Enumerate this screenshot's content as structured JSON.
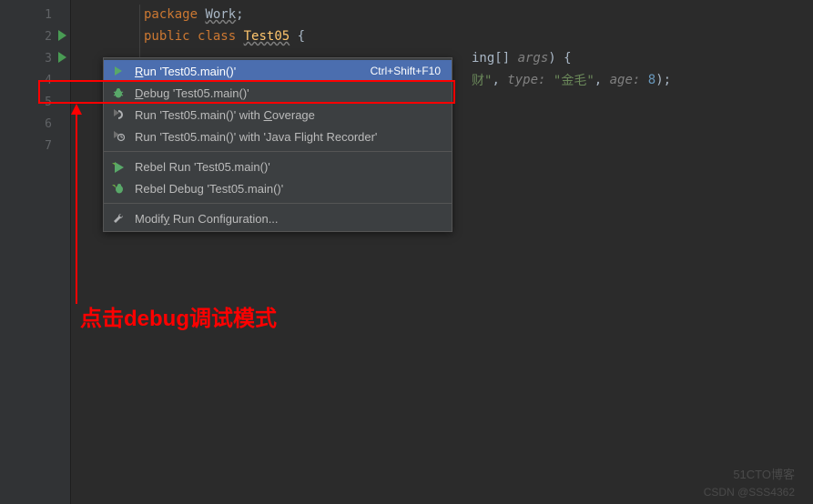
{
  "gutter": {
    "lines": [
      "1",
      "2",
      "3",
      "4",
      "5",
      "6",
      "7"
    ]
  },
  "code": {
    "line1": {
      "kw": "package",
      "name": "Work",
      "semi": ";"
    },
    "line2": {
      "kw1": "public",
      "kw2": "class",
      "cls": "Test05",
      "brace": " {"
    },
    "line3_tail": {
      "type": "ing[] ",
      "arg": "args",
      "paren": ") {"
    },
    "line4_tail": {
      "str1": "财\"",
      "param1": "type:",
      "str2": "\"金毛\"",
      "param2": "age:",
      "num": "8",
      "end": ");"
    }
  },
  "menu": {
    "items": [
      {
        "icon": "run",
        "label_pre": "",
        "label_u": "R",
        "label_post": "un 'Test05.main()'",
        "shortcut": "Ctrl+Shift+F10"
      },
      {
        "icon": "debug",
        "label_pre": "",
        "label_u": "D",
        "label_post": "ebug 'Test05.main()'"
      },
      {
        "icon": "coverage",
        "label_pre": "Run 'Test05.main()' with ",
        "label_u": "C",
        "label_post": "overage"
      },
      {
        "icon": "flight",
        "label_pre": "Run 'Test05.main()' with 'Java Flight Recorder'"
      },
      {
        "separator": true
      },
      {
        "icon": "jrebel-run",
        "label_pre": "Rebel Run 'Test05.main()'"
      },
      {
        "icon": "jrebel-debug",
        "label_pre": "Rebel Debug 'Test05.main()'"
      },
      {
        "separator": true
      },
      {
        "icon": "wrench",
        "label_pre": "Modif",
        "label_u": "y",
        "label_post": " Run Configuration..."
      }
    ]
  },
  "annotation": {
    "text": "点击debug调试模式"
  },
  "watermark": "51CTO博客",
  "watermark2": "CSDN @SSS4362"
}
